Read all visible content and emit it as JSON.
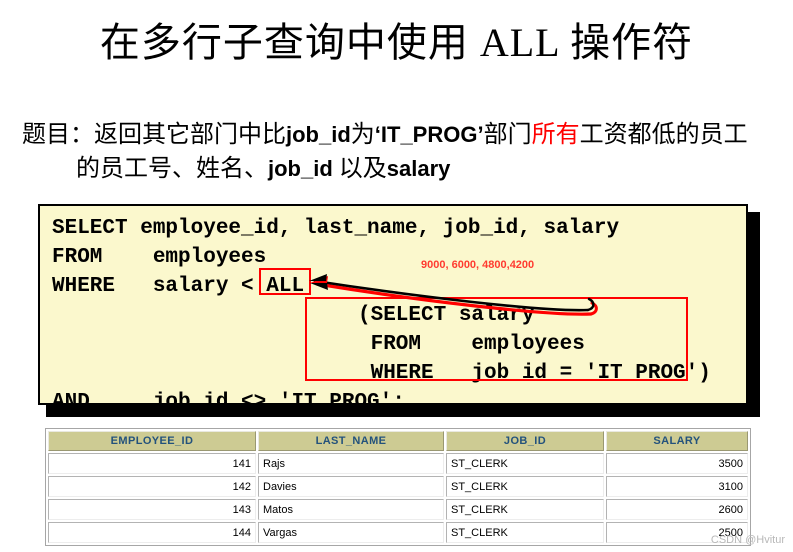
{
  "slide": {
    "title": "在多行子查询中使用 ALL 操作符",
    "question": {
      "lead": "题目：返回其它部门中比",
      "code1": "job_id",
      "mid1": "为",
      "code2": "‘IT_PROG’",
      "mid2": "部门",
      "highlight": "所有",
      "mid3": "工资都低的员工",
      "line2_lead": "的员工号、姓名、",
      "line2_code": "job_id",
      "line2_mid": " 以及",
      "line2_code2": "salary"
    }
  },
  "code": {
    "sql": "SELECT employee_id, last_name, job_id, salary\nFROM    employees\nWHERE   salary < ALL\n\n\n\nAND     job_id <> 'IT_PROG';",
    "subquery": "(SELECT salary\n FROM    employees\n WHERE   job_id = 'IT_PROG')",
    "all_keyword": "ALL",
    "annotation": "9000, 6000, 4800,4200",
    "colors": {
      "background": "#fbf8cd",
      "border": "#000000",
      "highlight_box": "#ff0000",
      "annotation_text": "#ff3b30"
    }
  },
  "result_grid": {
    "columns": [
      "EMPLOYEE_ID",
      "LAST_NAME",
      "JOB_ID",
      "SALARY"
    ],
    "rows": [
      {
        "employee_id": "141",
        "last_name": "Rajs",
        "job_id": "ST_CLERK",
        "salary": "3500"
      },
      {
        "employee_id": "142",
        "last_name": "Davies",
        "job_id": "ST_CLERK",
        "salary": "3100"
      },
      {
        "employee_id": "143",
        "last_name": "Matos",
        "job_id": "ST_CLERK",
        "salary": "2600"
      },
      {
        "employee_id": "144",
        "last_name": "Vargas",
        "job_id": "ST_CLERK",
        "salary": "2500"
      }
    ],
    "colors": {
      "header_bg": "#cdcb93",
      "header_text": "#23527c",
      "cell_bg": "#ffffff"
    }
  },
  "watermark": {
    "text": "CSDN @Hvitur"
  }
}
